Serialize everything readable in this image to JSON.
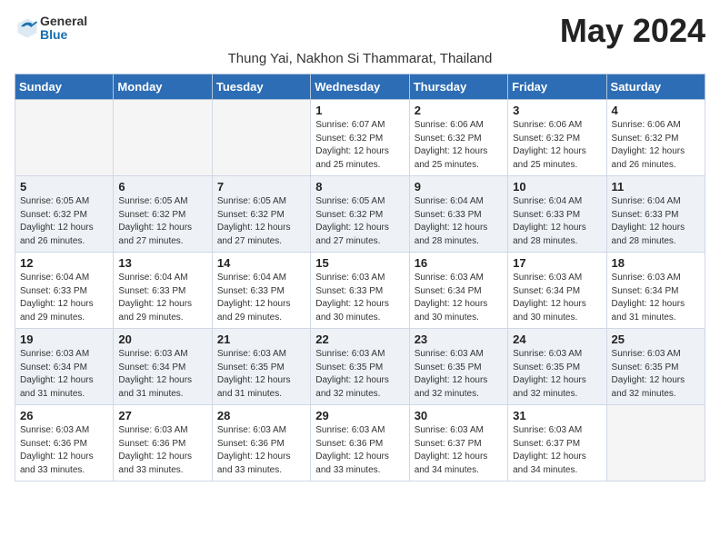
{
  "header": {
    "logo_general": "General",
    "logo_blue": "Blue",
    "month_year": "May 2024",
    "location": "Thung Yai, Nakhon Si Thammarat, Thailand"
  },
  "days_of_week": [
    "Sunday",
    "Monday",
    "Tuesday",
    "Wednesday",
    "Thursday",
    "Friday",
    "Saturday"
  ],
  "weeks": [
    [
      {
        "day": "",
        "info": ""
      },
      {
        "day": "",
        "info": ""
      },
      {
        "day": "",
        "info": ""
      },
      {
        "day": "1",
        "info": "Sunrise: 6:07 AM\nSunset: 6:32 PM\nDaylight: 12 hours\nand 25 minutes."
      },
      {
        "day": "2",
        "info": "Sunrise: 6:06 AM\nSunset: 6:32 PM\nDaylight: 12 hours\nand 25 minutes."
      },
      {
        "day": "3",
        "info": "Sunrise: 6:06 AM\nSunset: 6:32 PM\nDaylight: 12 hours\nand 25 minutes."
      },
      {
        "day": "4",
        "info": "Sunrise: 6:06 AM\nSunset: 6:32 PM\nDaylight: 12 hours\nand 26 minutes."
      }
    ],
    [
      {
        "day": "5",
        "info": "Sunrise: 6:05 AM\nSunset: 6:32 PM\nDaylight: 12 hours\nand 26 minutes."
      },
      {
        "day": "6",
        "info": "Sunrise: 6:05 AM\nSunset: 6:32 PM\nDaylight: 12 hours\nand 27 minutes."
      },
      {
        "day": "7",
        "info": "Sunrise: 6:05 AM\nSunset: 6:32 PM\nDaylight: 12 hours\nand 27 minutes."
      },
      {
        "day": "8",
        "info": "Sunrise: 6:05 AM\nSunset: 6:32 PM\nDaylight: 12 hours\nand 27 minutes."
      },
      {
        "day": "9",
        "info": "Sunrise: 6:04 AM\nSunset: 6:33 PM\nDaylight: 12 hours\nand 28 minutes."
      },
      {
        "day": "10",
        "info": "Sunrise: 6:04 AM\nSunset: 6:33 PM\nDaylight: 12 hours\nand 28 minutes."
      },
      {
        "day": "11",
        "info": "Sunrise: 6:04 AM\nSunset: 6:33 PM\nDaylight: 12 hours\nand 28 minutes."
      }
    ],
    [
      {
        "day": "12",
        "info": "Sunrise: 6:04 AM\nSunset: 6:33 PM\nDaylight: 12 hours\nand 29 minutes."
      },
      {
        "day": "13",
        "info": "Sunrise: 6:04 AM\nSunset: 6:33 PM\nDaylight: 12 hours\nand 29 minutes."
      },
      {
        "day": "14",
        "info": "Sunrise: 6:04 AM\nSunset: 6:33 PM\nDaylight: 12 hours\nand 29 minutes."
      },
      {
        "day": "15",
        "info": "Sunrise: 6:03 AM\nSunset: 6:33 PM\nDaylight: 12 hours\nand 30 minutes."
      },
      {
        "day": "16",
        "info": "Sunrise: 6:03 AM\nSunset: 6:34 PM\nDaylight: 12 hours\nand 30 minutes."
      },
      {
        "day": "17",
        "info": "Sunrise: 6:03 AM\nSunset: 6:34 PM\nDaylight: 12 hours\nand 30 minutes."
      },
      {
        "day": "18",
        "info": "Sunrise: 6:03 AM\nSunset: 6:34 PM\nDaylight: 12 hours\nand 31 minutes."
      }
    ],
    [
      {
        "day": "19",
        "info": "Sunrise: 6:03 AM\nSunset: 6:34 PM\nDaylight: 12 hours\nand 31 minutes."
      },
      {
        "day": "20",
        "info": "Sunrise: 6:03 AM\nSunset: 6:34 PM\nDaylight: 12 hours\nand 31 minutes."
      },
      {
        "day": "21",
        "info": "Sunrise: 6:03 AM\nSunset: 6:35 PM\nDaylight: 12 hours\nand 31 minutes."
      },
      {
        "day": "22",
        "info": "Sunrise: 6:03 AM\nSunset: 6:35 PM\nDaylight: 12 hours\nand 32 minutes."
      },
      {
        "day": "23",
        "info": "Sunrise: 6:03 AM\nSunset: 6:35 PM\nDaylight: 12 hours\nand 32 minutes."
      },
      {
        "day": "24",
        "info": "Sunrise: 6:03 AM\nSunset: 6:35 PM\nDaylight: 12 hours\nand 32 minutes."
      },
      {
        "day": "25",
        "info": "Sunrise: 6:03 AM\nSunset: 6:35 PM\nDaylight: 12 hours\nand 32 minutes."
      }
    ],
    [
      {
        "day": "26",
        "info": "Sunrise: 6:03 AM\nSunset: 6:36 PM\nDaylight: 12 hours\nand 33 minutes."
      },
      {
        "day": "27",
        "info": "Sunrise: 6:03 AM\nSunset: 6:36 PM\nDaylight: 12 hours\nand 33 minutes."
      },
      {
        "day": "28",
        "info": "Sunrise: 6:03 AM\nSunset: 6:36 PM\nDaylight: 12 hours\nand 33 minutes."
      },
      {
        "day": "29",
        "info": "Sunrise: 6:03 AM\nSunset: 6:36 PM\nDaylight: 12 hours\nand 33 minutes."
      },
      {
        "day": "30",
        "info": "Sunrise: 6:03 AM\nSunset: 6:37 PM\nDaylight: 12 hours\nand 34 minutes."
      },
      {
        "day": "31",
        "info": "Sunrise: 6:03 AM\nSunset: 6:37 PM\nDaylight: 12 hours\nand 34 minutes."
      },
      {
        "day": "",
        "info": ""
      }
    ]
  ]
}
